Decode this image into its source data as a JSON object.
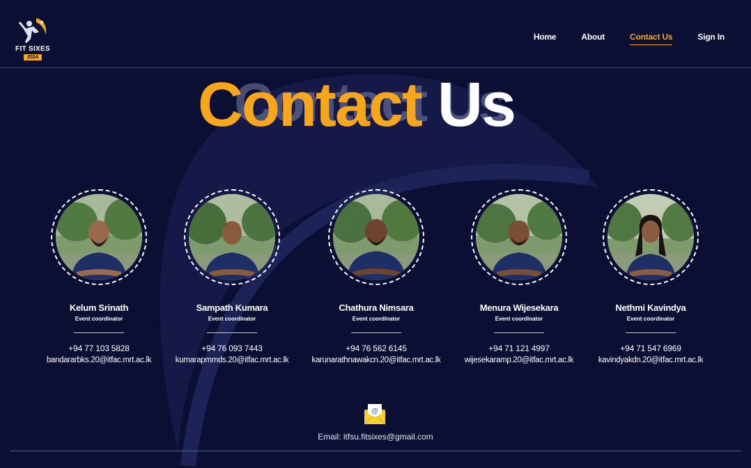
{
  "logo": {
    "text": "FIT SIXES",
    "year": "2024"
  },
  "nav": {
    "items": [
      {
        "label": "Home",
        "active": false
      },
      {
        "label": "About",
        "active": false
      },
      {
        "label": "Contact Us",
        "active": true
      },
      {
        "label": "Sign In",
        "active": false
      }
    ]
  },
  "hero": {
    "title_part1": "Contact",
    "title_part2": "Us",
    "ghost_text": "Contact Us"
  },
  "team": [
    {
      "name": "Kelum Srinath",
      "role": "Event coordinator",
      "phone": "+94 77 103 5828",
      "email": "bandararbks.20@itfac.mrt.ac.lk"
    },
    {
      "name": "Sampath Kumara",
      "role": "Event coordinator",
      "phone": "+94 76 093 7443",
      "email": "kumarapmmds.20@itfac.mrt.ac.lk"
    },
    {
      "name": "Chathura Nimsara",
      "role": "Event coordinator",
      "phone": "+94 76 562 6145",
      "email": "karunarathnawakcn.20@itfac.mrt.ac.lk"
    },
    {
      "name": "Menura Wijesekara",
      "role": "Event coordinator",
      "phone": "+94 71 121 4997",
      "email": "wijesekaramp.20@itfac.mrt.ac.lk"
    },
    {
      "name": "Nethmi Kavindya",
      "role": "Event coordinator",
      "phone": "+94 71 547 6969",
      "email": "kavindyakdn.20@itfac.mrt.ac.lk"
    }
  ],
  "footer": {
    "email_text": "Email: itfsu.fitsixes@gmail.com",
    "mail_icon": "envelope-icon"
  },
  "colors": {
    "background": "#0b0f33",
    "accent": "#f9a61a",
    "text": "#ffffff"
  }
}
